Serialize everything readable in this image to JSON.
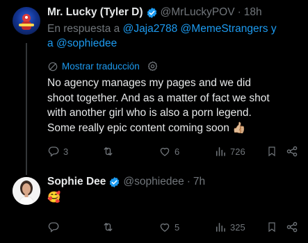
{
  "tweets": [
    {
      "name": "Mr. Lucky (Tyler D)",
      "handle": "@MrLuckyPOV",
      "dot": "·",
      "time": "18h",
      "reply_prefix": "En respuesta a",
      "reply_mentions": [
        "@Jaja2788",
        "@MemeStrangers",
        "y",
        "a",
        "@sophiedee"
      ],
      "translate_label": "Mostrar traducción",
      "body_lines": [
        "No agency manages my  pages and we did",
        "shoot together. And as a matter of fact we shot",
        "with another girl who is also a porn legend.",
        "Some really epic content coming soon"
      ],
      "body_emoji": "👍🏼",
      "stats": {
        "replies": "3",
        "retweets": "",
        "likes": "6",
        "views": "726"
      }
    },
    {
      "name": "Sophie Dee",
      "handle": "@sophiedee",
      "dot": "·",
      "time": "7h",
      "body_emoji": "🥰",
      "stats": {
        "replies": "",
        "retweets": "",
        "likes": "5",
        "views": "325"
      }
    }
  ],
  "colors": {
    "background": "#000000",
    "text": "#e7e9ea",
    "muted": "#71767b",
    "link": "#1d9bf0",
    "verified": "#1d9bf0",
    "thread_line": "#333639"
  },
  "icons": [
    "reply-icon",
    "retweet-icon",
    "like-icon",
    "views-icon",
    "share-icon",
    "verified-badge-icon",
    "translate-globe-icon",
    "gear-icon"
  ]
}
